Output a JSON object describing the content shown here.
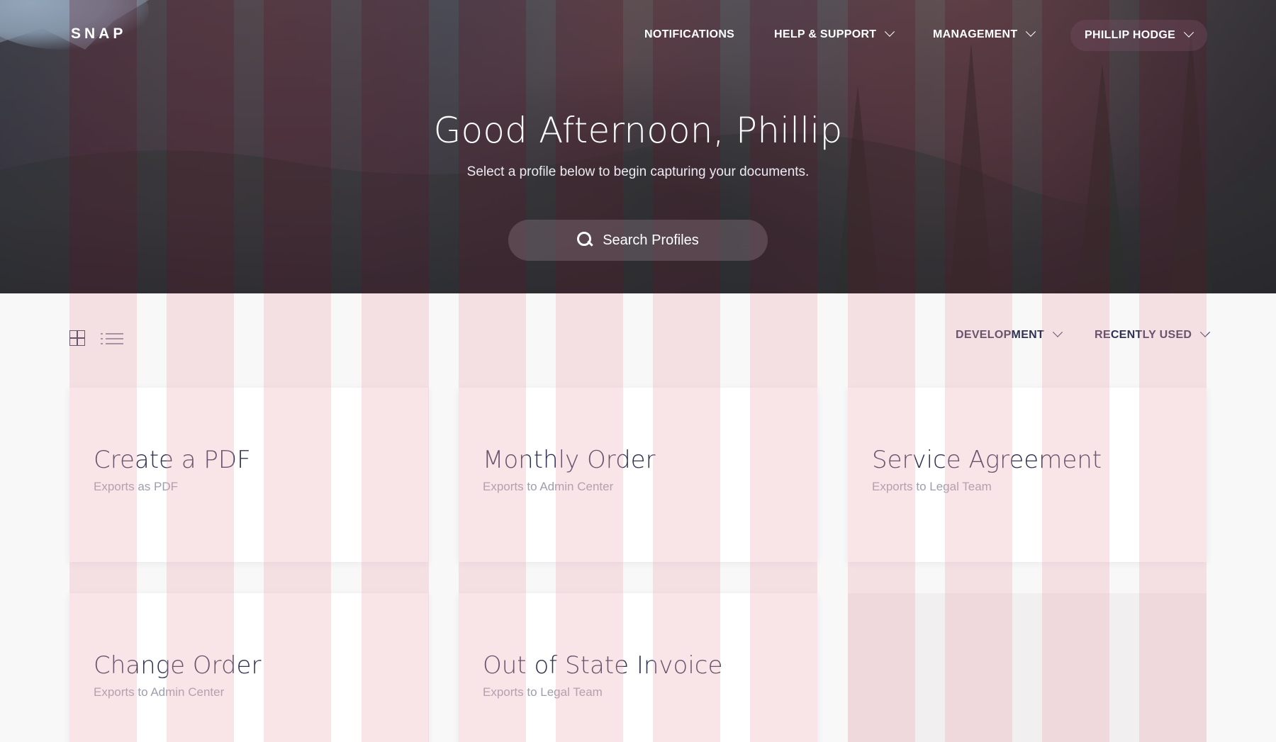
{
  "app": {
    "logo": "SNAP"
  },
  "nav": {
    "items": [
      {
        "label": "NOTIFICATIONS",
        "has_dropdown": false
      },
      {
        "label": "HELP & SUPPORT",
        "has_dropdown": true
      },
      {
        "label": "MANAGEMENT",
        "has_dropdown": true
      }
    ],
    "user_menu": {
      "label": "PHILLIP HODGE",
      "has_dropdown": true
    }
  },
  "hero": {
    "greeting": "Good Afternoon, Phillip",
    "subtitle": "Select a profile below to begin capturing your documents.",
    "search": {
      "placeholder": "Search Profiles",
      "icon": "search-icon"
    }
  },
  "toolbar": {
    "view_modes": [
      {
        "name": "grid",
        "icon": "grid-icon",
        "active": true
      },
      {
        "name": "list",
        "icon": "list-icon",
        "active": false
      }
    ],
    "filter": {
      "label": "DEVELOPMENT"
    },
    "sort": {
      "label": "RECENTLY USED"
    }
  },
  "profiles": [
    {
      "name": "Create a PDF",
      "destination": "Exports as PDF"
    },
    {
      "name": "Monthly Order",
      "destination": "Exports to Admin Center"
    },
    {
      "name": "Service Agreement",
      "destination": "Exports to Legal Team"
    },
    {
      "name": "Change Order",
      "destination": "Exports to Admin Center"
    },
    {
      "name": "Out of State Invoice",
      "destination": "Exports to Legal Team"
    }
  ],
  "colors": {
    "text_primary": "#2f3151",
    "text_secondary": "#9c9eae",
    "background": "#f8f8f9",
    "card": "#ffffff",
    "grid_overlay": "#eca5af"
  }
}
